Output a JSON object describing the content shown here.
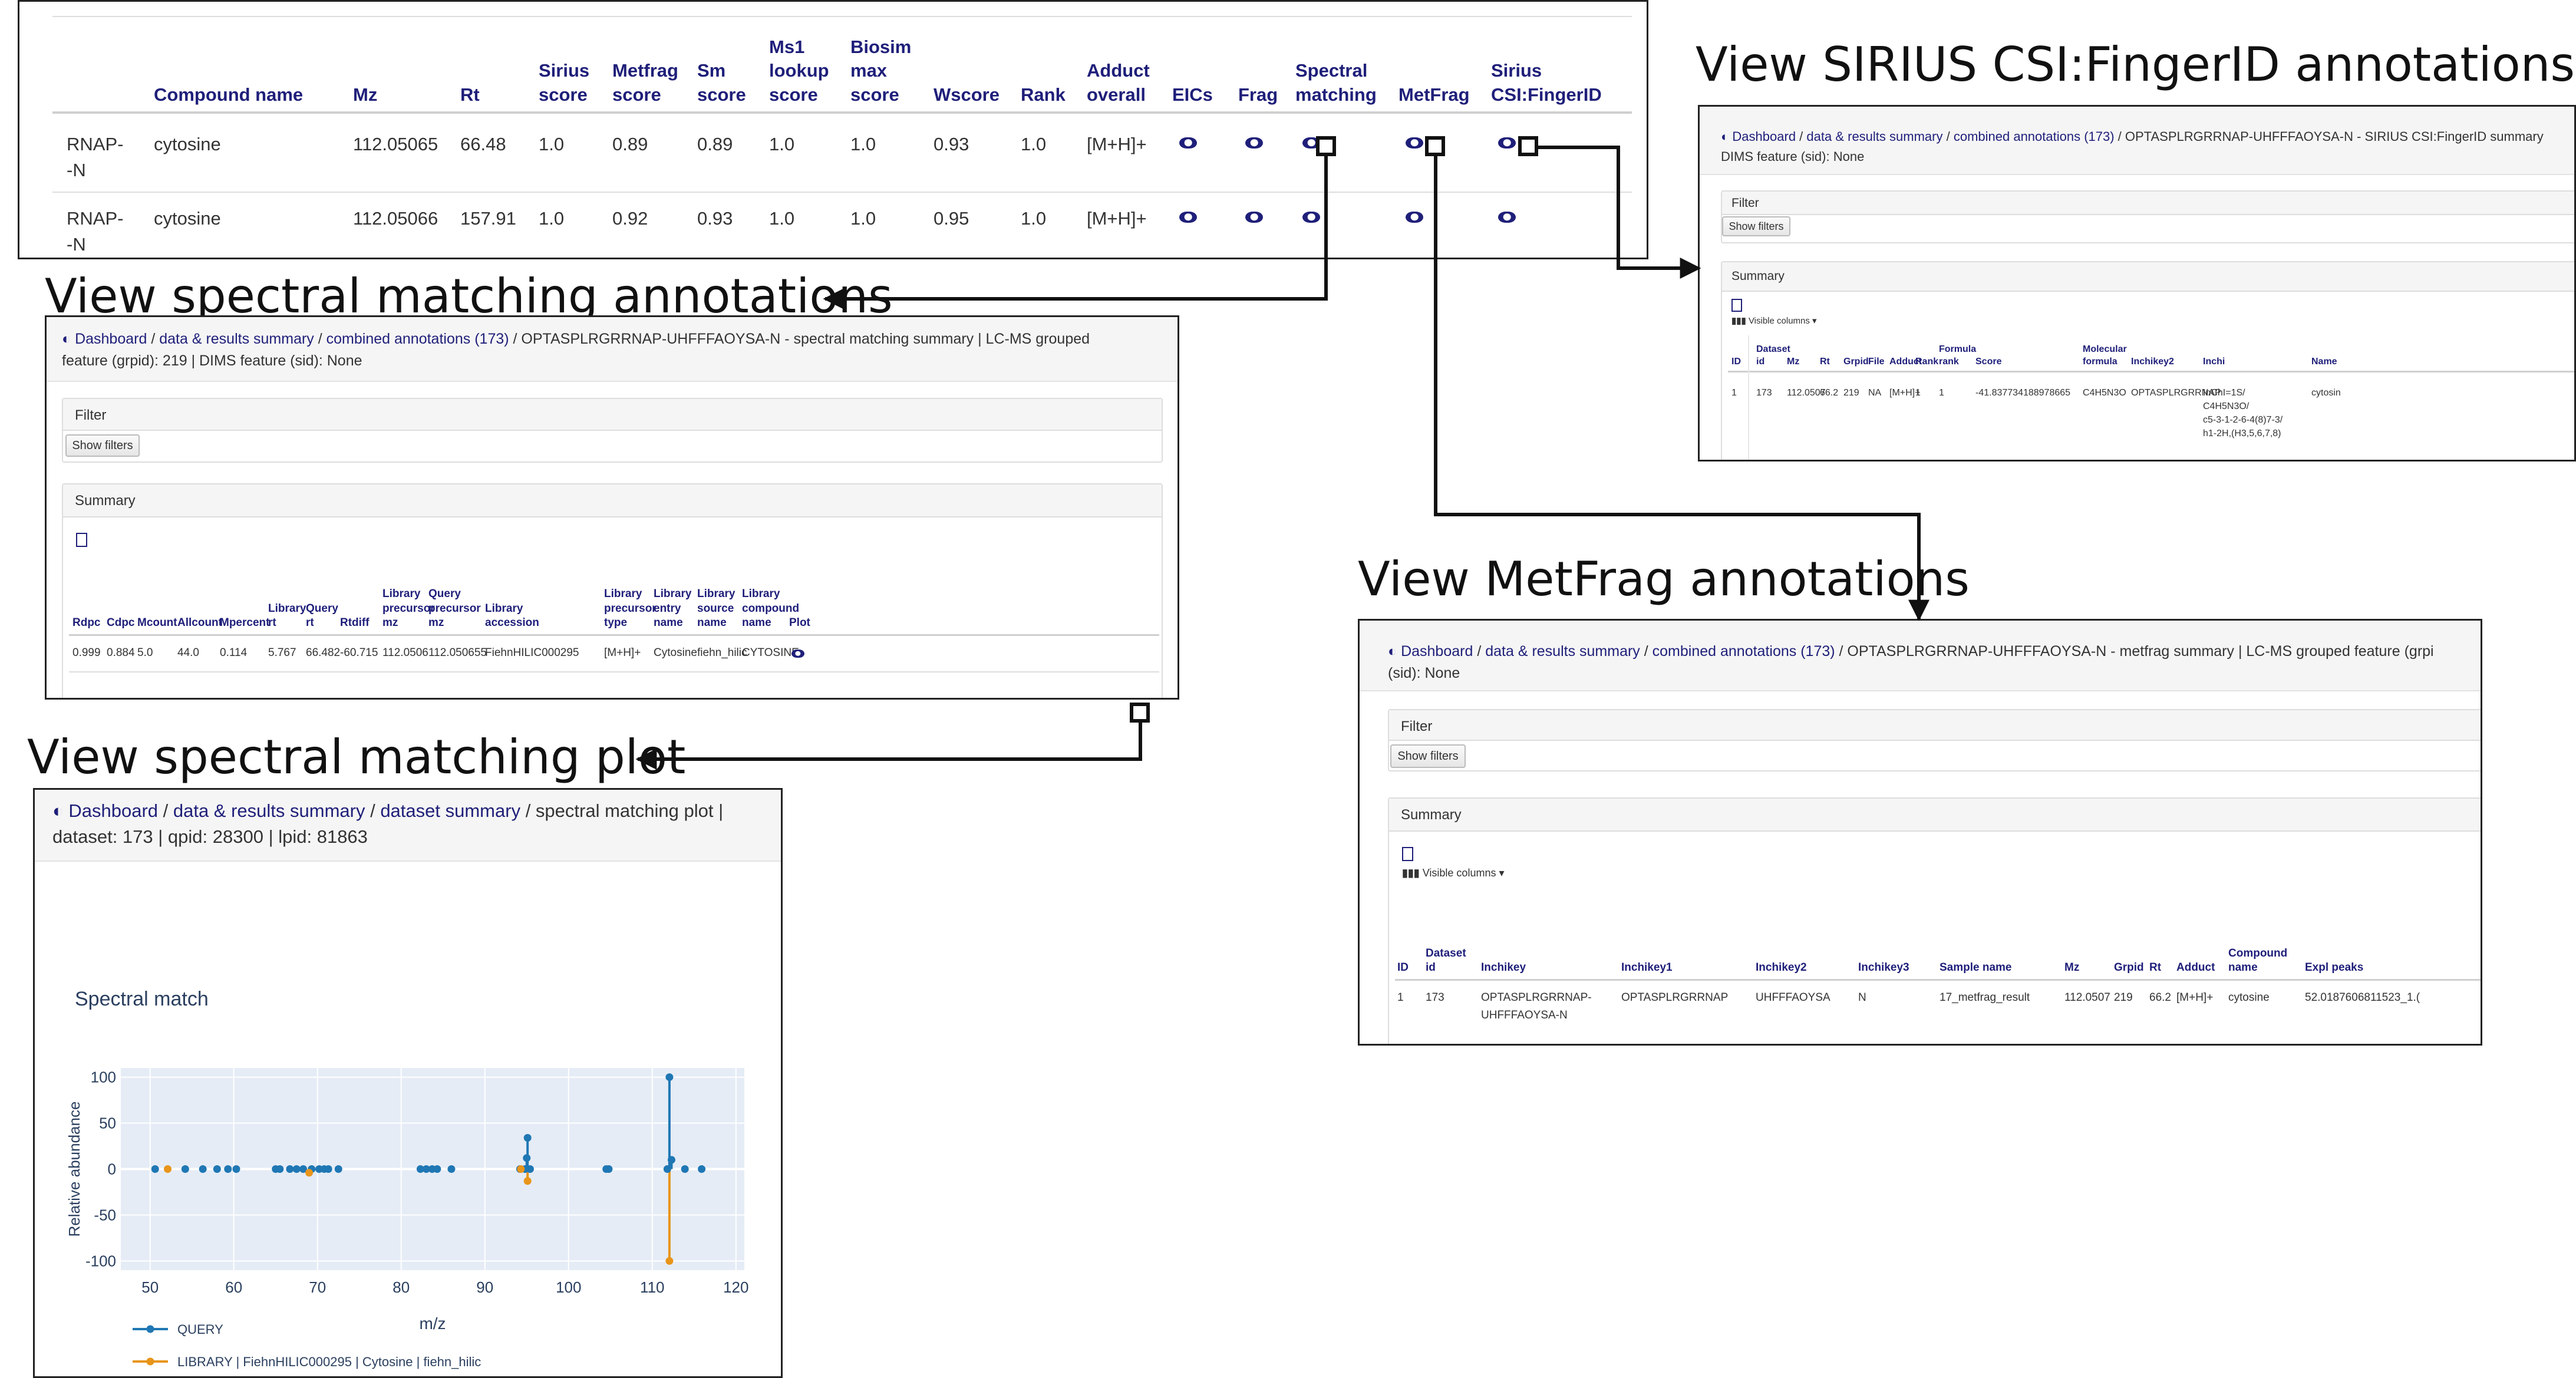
{
  "captions": {
    "sirius": "View SIRIUS CSI:FingerID annotations",
    "spectral_annotations": "View spectral matching annotations",
    "metfrag": "View MetFrag annotations",
    "spectral_plot": "View spectral matching plot"
  },
  "main_table": {
    "headers": [
      [
        "Compound name"
      ],
      [
        "Mz"
      ],
      [
        "Rt"
      ],
      [
        "Sirius",
        "score"
      ],
      [
        "Metfrag",
        "score"
      ],
      [
        "Sm",
        "score"
      ],
      [
        "Ms1",
        "lookup",
        "score"
      ],
      [
        "Biosim",
        "max",
        "score"
      ],
      [
        "Wscore"
      ],
      [
        "Rank"
      ],
      [
        "Adduct",
        "overall"
      ],
      [
        "EICs"
      ],
      [
        "Frag"
      ],
      [
        "Spectral",
        "matching"
      ],
      [
        "MetFrag"
      ],
      [
        "Sirius",
        "CSI:FingerID"
      ]
    ],
    "rows": [
      {
        "inchikey_fragment": [
          "RNAP-",
          "-N"
        ],
        "cells": [
          "cytosine",
          "112.05065",
          "66.48",
          "1.0",
          "0.89",
          "0.89",
          "1.0",
          "1.0",
          "0.93",
          "1.0",
          "[M+H]+"
        ]
      },
      {
        "inchikey_fragment": [
          "RNAP-",
          "-N"
        ],
        "cells": [
          "cytosine",
          "112.05066",
          "157.91",
          "1.0",
          "0.92",
          "0.93",
          "1.0",
          "1.0",
          "0.95",
          "1.0",
          "[M+H]+"
        ]
      }
    ]
  },
  "breadcrumb": {
    "dashboard": "Dashboard",
    "sep": " / ",
    "data_results": "data & results summary",
    "combined": "combined annotations (173)",
    "dataset_summary": "dataset summary"
  },
  "sirius_panel": {
    "title_rest": " / OPTASPLRGRRNAP-UHFFFAOYSA-N - SIRIUS CSI:FingerID summary",
    "title_line2": "DIMS feature (sid): None",
    "filter": "Filter",
    "show_filters": "Show filters",
    "summary": "Summary",
    "visible_columns": "Visible columns",
    "headers": [
      [
        "ID"
      ],
      [
        "Dataset",
        "id"
      ],
      [
        "Mz"
      ],
      [
        "Rt"
      ],
      [
        "Grpid"
      ],
      [
        "File"
      ],
      [
        "Adduct"
      ],
      [
        "Rank"
      ],
      [
        "Formula",
        "rank"
      ],
      [
        "Score"
      ],
      [
        "Molecular",
        "formula"
      ],
      [
        "Inchikey2"
      ],
      [
        "Inchi"
      ],
      [
        "Name"
      ]
    ],
    "row": [
      "1",
      "173",
      "112.0507",
      "66.2",
      "219",
      "NA",
      "[M+H]+",
      "1",
      "1",
      "-41.837734188978665",
      "C4H5N3O",
      "OPTASPLRGRRNAP"
    ],
    "inchi_lines": [
      "InChI=1S/",
      "C4H5N3O/",
      "c5-3-1-2-6-4(8)7-3/",
      "h1-2H,(H3,5,6,7,8)"
    ],
    "name": "cytosin"
  },
  "spectral_panel": {
    "title_rest": " / OPTASPLRGRRNAP-UHFFFAOYSA-N - spectral matching summary | LC-MS grouped",
    "title_line2": "feature (grpid): 219 | DIMS feature (sid): None",
    "filter": "Filter",
    "show_filters": "Show filters",
    "summary": "Summary",
    "headers": [
      [
        "Rdpc"
      ],
      [
        "Cdpc"
      ],
      [
        "Mcount"
      ],
      [
        "Allcount"
      ],
      [
        "Mpercent"
      ],
      [
        "Library",
        "rt"
      ],
      [
        "Query",
        "rt"
      ],
      [
        "Rtdiff"
      ],
      [
        "Library",
        "precursor",
        "mz"
      ],
      [
        "Query",
        "precursor",
        "mz"
      ],
      [
        "Library",
        "accession"
      ],
      [
        "Library",
        "precursor",
        "type"
      ],
      [
        "Library",
        "entry",
        "name"
      ],
      [
        "Library",
        "source",
        "name"
      ],
      [
        "Library",
        "compound",
        "name"
      ],
      [
        "Plot"
      ]
    ],
    "row": [
      "0.999",
      "0.884",
      "5.0",
      "44.0",
      "0.114",
      "5.767",
      "66.482",
      "-60.715",
      "112.0506",
      "112.050655",
      "FiehnHILIC000295",
      "[M+H]+",
      "Cytosine",
      "fiehn_hilic",
      "CYTOSINE"
    ]
  },
  "metfrag_panel": {
    "title_rest": " / OPTASPLRGRRNAP-UHFFFAOYSA-N - metfrag summary | LC-MS grouped feature (grpi",
    "title_line2": "(sid): None",
    "filter": "Filter",
    "show_filters": "Show filters",
    "summary": "Summary",
    "visible_columns": "Visible columns",
    "headers": [
      [
        "ID"
      ],
      [
        "Dataset",
        "id"
      ],
      [
        "Inchikey"
      ],
      [
        "Inchikey1"
      ],
      [
        "Inchikey2"
      ],
      [
        "Inchikey3"
      ],
      [
        "Sample name"
      ],
      [
        "Mz"
      ],
      [
        "Grpid"
      ],
      [
        "Rt"
      ],
      [
        "Adduct"
      ],
      [
        "Compound",
        "name"
      ],
      [
        "Expl peaks"
      ]
    ],
    "row": [
      "1",
      "173",
      "OPTASPLRGRRNAP-",
      "OPTASPLRGRRNAP",
      "UHFFFAOYSA",
      "N",
      "17_metfrag_result",
      "112.0507",
      "219",
      "66.2",
      "[M+H]+",
      "cytosine",
      "52.0187606811523_1.("
    ],
    "row_inchikey_line2": "UHFFFAOYSA-N"
  },
  "plot_panel": {
    "title_rest": " / spectral matching plot |",
    "title_line2": "dataset: 173 | qpid: 28300 | lpid: 81863"
  },
  "chart_data": {
    "type": "scatter",
    "title": "Spectral match",
    "xlabel": "m/z",
    "ylabel": "Relative abundance",
    "xlim": [
      46.5,
      121
    ],
    "ylim": [
      -110,
      110
    ],
    "xticks": [
      50,
      60,
      70,
      80,
      90,
      100,
      110,
      120
    ],
    "yticks": [
      100,
      50,
      0,
      -50,
      -100
    ],
    "grid": true,
    "legend_position": "bottom-left",
    "series": [
      {
        "name": "QUERY",
        "color": "#1f77b4",
        "x": [
          50.6,
          54.2,
          56.3,
          58.0,
          59.3,
          60.3,
          65.0,
          65.5,
          66.7,
          67.5,
          68.3,
          69.3,
          70.2,
          70.8,
          71.3,
          72.5,
          82.3,
          83.0,
          83.7,
          84.3,
          86.0,
          94.2,
          94.8,
          95.0,
          95.1,
          95.4,
          104.5,
          104.8,
          111.8,
          112.05,
          112.3,
          113.9,
          115.9
        ],
        "y": [
          0,
          0,
          0,
          0,
          0,
          0,
          0,
          0,
          0,
          0,
          0,
          0,
          0,
          0,
          0,
          0,
          0,
          0,
          0,
          0,
          0,
          0,
          0,
          12,
          34,
          0,
          0,
          0,
          0,
          100,
          10,
          0,
          0
        ]
      },
      {
        "name": "LIBRARY | FiehnHILIC000295 | Cytosine | fiehn_hilic",
        "color": "#e8951a",
        "x": [
          52.1,
          69.0,
          94.3,
          95.1,
          112.05
        ],
        "y": [
          0,
          -4,
          0,
          -13,
          -100
        ]
      }
    ]
  }
}
